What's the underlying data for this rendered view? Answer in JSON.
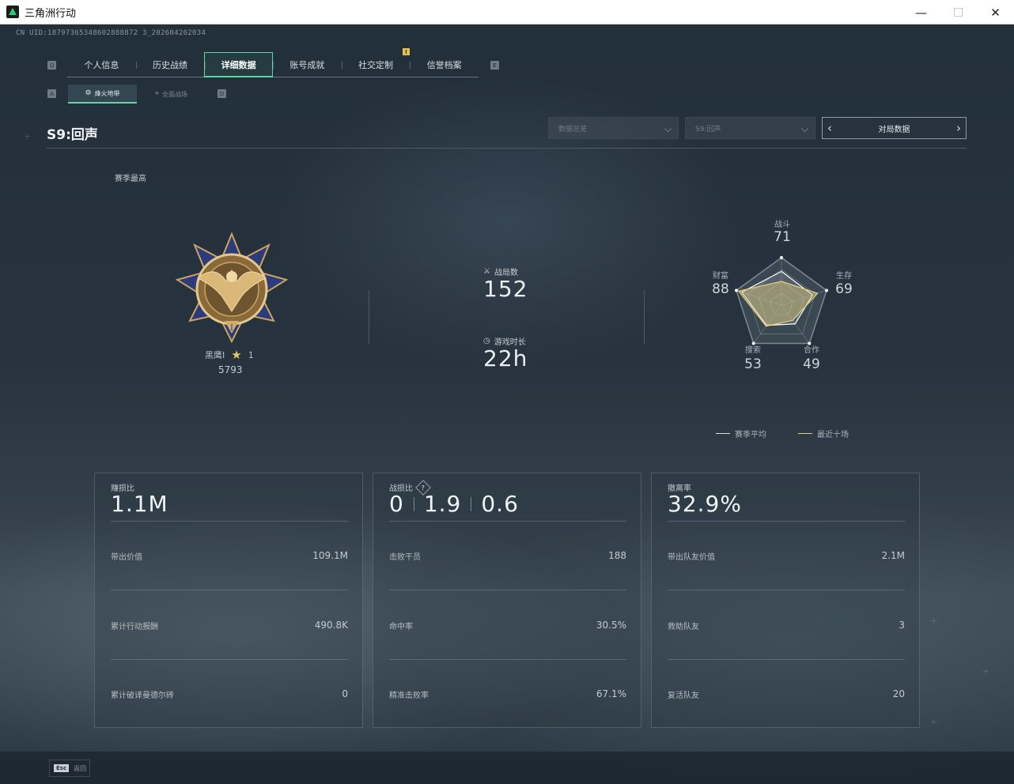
{
  "window": {
    "title": "三角洲行动",
    "controls": [
      "—",
      "☐",
      "✕"
    ]
  },
  "header": {
    "cnuid": "CN UID:18797365348602888872 3_202604262034"
  },
  "tabs": {
    "left_key": "Q",
    "right_key": "E",
    "items": [
      {
        "label": "个人信息"
      },
      {
        "label": "历史战绩"
      },
      {
        "label": "详细数据",
        "active": true
      },
      {
        "label": "账号成就"
      },
      {
        "label": "社交定制"
      },
      {
        "label": "信誉档案"
      }
    ],
    "badge": "!"
  },
  "subtabs": {
    "left_key": "A",
    "right_key": "D",
    "items": [
      {
        "label": "烽火地带",
        "icon": "fire-icon",
        "active": true
      },
      {
        "label": "全面战场",
        "icon": "target-icon"
      }
    ]
  },
  "season": {
    "title": "S9:回声",
    "section_label": "赛季最高"
  },
  "filters": {
    "overview": "数据总览",
    "season": "S9:回声",
    "match_data": "对局数据"
  },
  "rank": {
    "name": "黑鹰I",
    "stars": "1",
    "score": "5793"
  },
  "stats": {
    "matches_label": "战局数",
    "matches_value": "152",
    "time_label": "游戏时长",
    "time_value": "22h"
  },
  "radar": {
    "axes": [
      {
        "label": "战斗",
        "value": "71"
      },
      {
        "label": "生存",
        "value": "69"
      },
      {
        "label": "合作",
        "value": "49"
      },
      {
        "label": "搜索",
        "value": "53"
      },
      {
        "label": "财富",
        "value": "88"
      }
    ],
    "season_avg": [
      71,
      69,
      49,
      53,
      88
    ],
    "recent_ten": [
      50,
      80,
      40,
      55,
      95
    ],
    "legend": {
      "season_avg": "赛季平均",
      "recent_ten": "最近十场"
    },
    "colors": {
      "season_avg": "#ffffff",
      "recent_ten": "#e4cf80"
    }
  },
  "panels": [
    {
      "title": "赚损比",
      "big": [
        "1.1M"
      ],
      "rows": [
        {
          "label": "带出价值",
          "value": "109.1M"
        },
        {
          "label": "累计行动报酬",
          "value": "490.8K"
        },
        {
          "label": "累计破译曼德尔砖",
          "value": "0"
        }
      ]
    },
    {
      "title": "战损比",
      "help": "?",
      "big": [
        "0",
        "1.9",
        "0.6"
      ],
      "rows": [
        {
          "label": "击败干员",
          "value": "188"
        },
        {
          "label": "命中率",
          "value": "30.5%"
        },
        {
          "label": "精准击败率",
          "value": "67.1%"
        }
      ]
    },
    {
      "title": "撤离率",
      "big": [
        "32.9%"
      ],
      "rows": [
        {
          "label": "带出队友价值",
          "value": "2.1M"
        },
        {
          "label": "救助队友",
          "value": "3"
        },
        {
          "label": "复活队友",
          "value": "20"
        }
      ]
    }
  ],
  "footer": {
    "esc_key": "Esc",
    "back_label": "返回"
  }
}
